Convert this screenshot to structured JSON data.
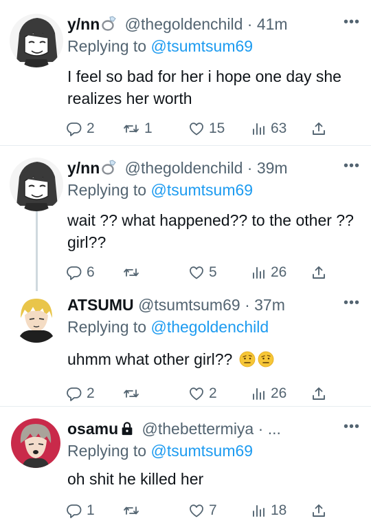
{
  "tweets": [
    {
      "name": "y/nn",
      "name_badge": "ring-emoji",
      "handle": "@thegoldenchild",
      "separator": "·",
      "time": "41m",
      "replying_label": "Replying to",
      "replying_to": "@tsumtsum69",
      "text": "I feel so bad for her i hope one day she realizes her worth",
      "text_emoji": "",
      "stats": {
        "replies": "2",
        "retweets": "1",
        "likes": "15",
        "views": "63"
      },
      "avatar": "anime-girl-sketch"
    },
    {
      "name": "y/nn",
      "name_badge": "ring-emoji",
      "handle": "@thegoldenchild",
      "separator": "·",
      "time": "39m",
      "replying_label": "Replying to",
      "replying_to": "@tsumtsum69",
      "text": "wait ?? what happened?? to the other ?? girl??",
      "text_emoji": "",
      "stats": {
        "replies": "6",
        "retweets": "",
        "likes": "5",
        "views": "26"
      },
      "avatar": "anime-girl-sketch"
    },
    {
      "name": "ATSUMU",
      "name_badge": "",
      "handle": "@tsumtsum69",
      "separator": "·",
      "time": "37m",
      "replying_label": "Replying to",
      "replying_to": "@thegoldenchild",
      "text": "uhmm what other girl??",
      "text_emoji": "raised-eyebrow-emoji x2",
      "stats": {
        "replies": "2",
        "retweets": "",
        "likes": "2",
        "views": "26"
      },
      "avatar": "blond-boy-anime"
    },
    {
      "name": "osamu",
      "name_badge": "lock-icon",
      "handle": "@thebettermiya",
      "separator": "·",
      "time": "...",
      "replying_label": "Replying to",
      "replying_to": "@tsumtsum69",
      "text": "oh shit he killed her",
      "text_emoji": "",
      "stats": {
        "replies": "1",
        "retweets": "",
        "likes": "7",
        "views": "18"
      },
      "avatar": "grey-hair-boy-anime"
    }
  ],
  "colors": {
    "text": "#0f1419",
    "secondary": "#536471",
    "link": "#1d9bf0",
    "divider": "#e6ecf0",
    "thread_line": "#cfd9de"
  }
}
